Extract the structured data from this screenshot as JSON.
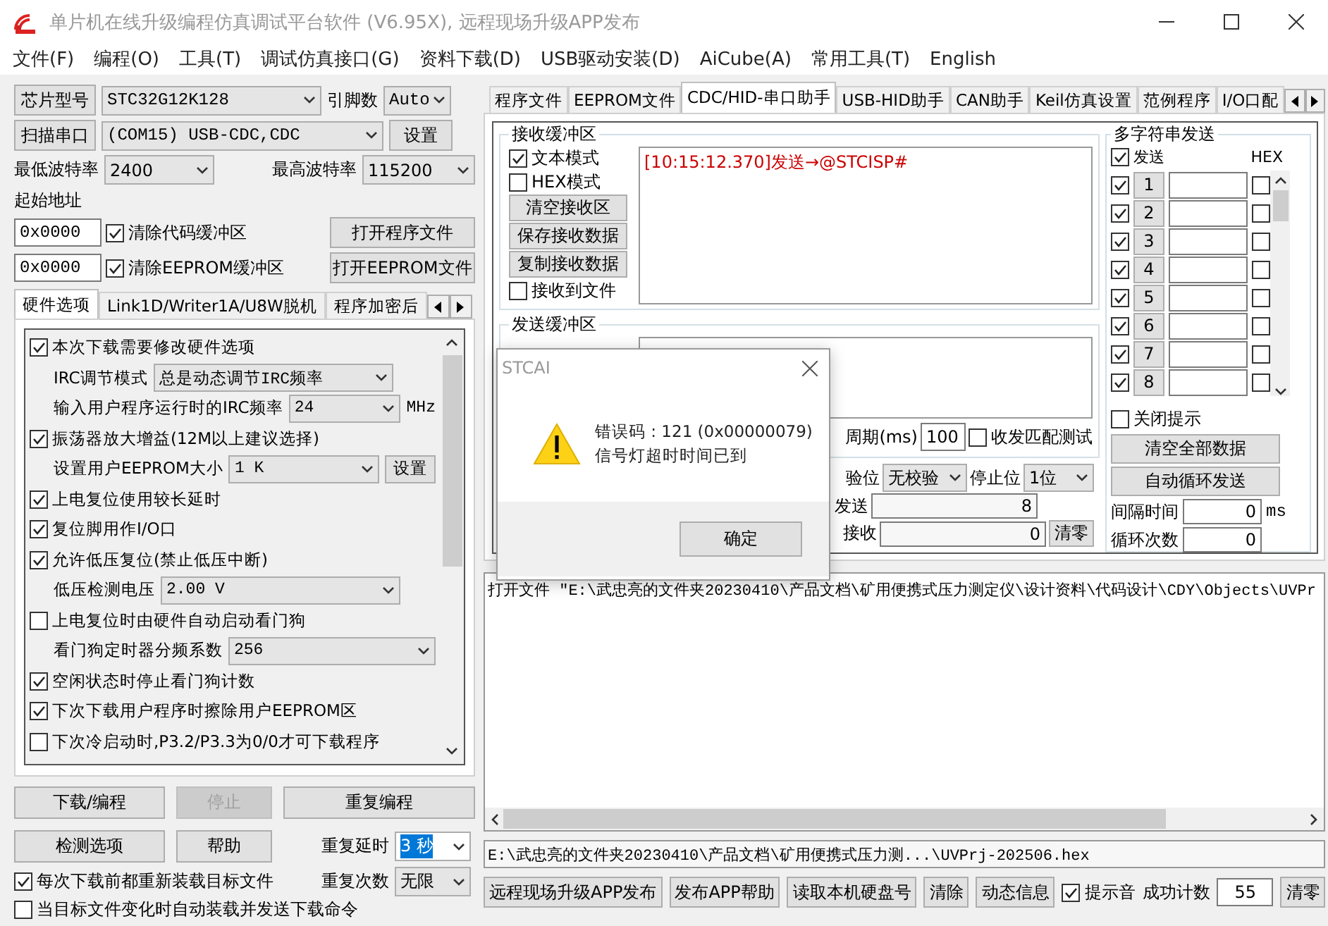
{
  "window": {
    "title": "单片机在线升级编程仿真调试平台软件 (V6.95X), 远程现场升级APP发布"
  },
  "menu": [
    "文件(F)",
    "编程(O)",
    "工具(T)",
    "调试仿真接口(G)",
    "资料下载(D)",
    "USB驱动安装(D)",
    "AiCube(A)",
    "常用工具(T)",
    "English"
  ],
  "chip": {
    "button": "芯片型号",
    "model": "STC32G12K128",
    "pins_label": "引脚数",
    "pins": "Auto"
  },
  "port": {
    "button": "扫描串口",
    "value": "(COM15) USB-CDC,CDC",
    "settings": "设置"
  },
  "baud": {
    "min_label": "最低波特率",
    "min": "2400",
    "max_label": "最高波特率",
    "max": "115200"
  },
  "start_address": {
    "label": "起始地址",
    "rows": [
      {
        "address": "0x0000",
        "label": "清除代码缓冲区",
        "checked": true,
        "button": "打开程序文件"
      },
      {
        "address": "0x0000",
        "label": "清除EEPROM缓冲区",
        "checked": true,
        "button": "打开EEPROM文件"
      }
    ]
  },
  "left_tabs": [
    {
      "label": "硬件选项",
      "selected": true
    },
    {
      "label": "Link1D/Writer1A/U8W脱机",
      "selected": false
    },
    {
      "label": "程序加密后",
      "selected": false
    }
  ],
  "hardware_options": [
    {
      "kind": "check",
      "label": "本次下载需要修改硬件选项",
      "checked": true
    },
    {
      "kind": "select",
      "label": "IRC调节模式",
      "value": "总是动态调节IRC频率"
    },
    {
      "kind": "select",
      "label": "输入用户程序运行时的IRC频率",
      "value": "24",
      "unit": "MHz"
    },
    {
      "kind": "check",
      "label": "振荡器放大增益(12M以上建议选择)",
      "checked": true
    },
    {
      "kind": "select",
      "label": "设置用户EEPROM大小",
      "value": "1    K",
      "button": "设置"
    },
    {
      "kind": "check",
      "label": "上电复位使用较长延时",
      "checked": true
    },
    {
      "kind": "check",
      "label": "复位脚用作I/O口",
      "checked": true
    },
    {
      "kind": "check",
      "label": "允许低压复位(禁止低压中断)",
      "checked": true
    },
    {
      "kind": "select",
      "label": "低压检测电压",
      "value": "2.00 V"
    },
    {
      "kind": "check",
      "label": "上电复位时由硬件自动启动看门狗",
      "checked": false
    },
    {
      "kind": "select",
      "label": "看门狗定时器分频系数",
      "value": "256"
    },
    {
      "kind": "check",
      "label": "空闲状态时停止看门狗计数",
      "checked": true
    },
    {
      "kind": "check",
      "label": "下次下载用户程序时擦除用户EEPROM区",
      "checked": true
    },
    {
      "kind": "check",
      "label": "下次冷启动时,P3.2/P3.3为0/0才可下载程序",
      "checked": false
    }
  ],
  "actions": [
    {
      "label": "下载/编程",
      "disabled": false
    },
    {
      "label": "停止",
      "disabled": true
    },
    {
      "label": "重复编程",
      "disabled": false
    },
    {
      "label": "检测选项",
      "disabled": false
    },
    {
      "label": "帮助",
      "disabled": false
    }
  ],
  "repeat": {
    "delay_label": "重复延时",
    "delay": "3 秒",
    "count_label": "重复次数",
    "count": "无限"
  },
  "reload_options": [
    {
      "label": "每次下载前都重新装载目标文件",
      "checked": true
    },
    {
      "label": "当目标文件变化时自动装载并发送下载命令",
      "checked": false
    }
  ],
  "right_tabs": [
    {
      "label": "程序文件",
      "selected": false
    },
    {
      "label": "EEPROM文件",
      "selected": false
    },
    {
      "label": "CDC/HID-串口助手",
      "selected": true
    },
    {
      "label": "USB-HID助手",
      "selected": false
    },
    {
      "label": "CAN助手",
      "selected": false
    },
    {
      "label": "Keil仿真设置",
      "selected": false
    },
    {
      "label": "范例程序",
      "selected": false
    },
    {
      "label": "I/O口配",
      "selected": false
    }
  ],
  "receive": {
    "title": "接收缓冲区",
    "options": [
      {
        "label": "文本模式",
        "checked": true
      },
      {
        "label": "HEX模式",
        "checked": false
      }
    ],
    "buttons": [
      "清空接收区",
      "保存接收数据",
      "复制接收数据"
    ],
    "to_file": {
      "label": "接收到文件",
      "checked": false
    },
    "log": "[10:15:12.370]发送→@STCISP#"
  },
  "send": {
    "title": "发送缓冲区",
    "period_label": "周期(ms)",
    "period": "100",
    "match_test": {
      "label": "收发匹配测试",
      "checked": false
    },
    "parity_label": "验位",
    "parity": "无校验",
    "stop_label": "停止位",
    "stop": "1位",
    "sent_label": "发送",
    "sent": "8",
    "received_label": "接收",
    "received": "0",
    "clear": "清零"
  },
  "multi_send": {
    "title": "多字符串发送",
    "send_all": {
      "label": "发送",
      "checked": true
    },
    "hex_label": "HEX",
    "rows": [
      {
        "number": "1",
        "checked": true,
        "hex": false
      },
      {
        "number": "2",
        "checked": true,
        "hex": false
      },
      {
        "number": "3",
        "checked": true,
        "hex": false
      },
      {
        "number": "4",
        "checked": true,
        "hex": false
      },
      {
        "number": "5",
        "checked": true,
        "hex": false
      },
      {
        "number": "6",
        "checked": true,
        "hex": false
      },
      {
        "number": "7",
        "checked": true,
        "hex": false
      },
      {
        "number": "8",
        "checked": true,
        "hex": false
      }
    ],
    "close_hint": {
      "label": "关闭提示",
      "checked": false
    },
    "buttons": [
      "清空全部数据",
      "自动循环发送"
    ],
    "interval_label": "间隔时间",
    "interval": "0",
    "interval_unit": "ms",
    "loop_label": "循环次数",
    "loop": "0"
  },
  "output": {
    "text": "打开文件 \"E:\\武忠亮的文件夹20230410\\产品文档\\矿用便携式压力测定仪\\设计资料\\代码设计\\CDY\\Objects\\UVPr"
  },
  "file_path": "E:\\武忠亮的文件夹20230410\\产品文档\\矿用便携式压力测...\\UVPrj-202506.hex",
  "bottom_buttons": [
    "远程现场升级APP发布",
    "发布APP帮助",
    "读取本机硬盘号",
    "清除",
    "动态信息"
  ],
  "beep": {
    "label": "提示音",
    "checked": true
  },
  "success": {
    "label": "成功计数",
    "value": "55",
    "clear": "清零"
  },
  "dialog": {
    "title": "STCAI",
    "lines": [
      "错误码 : 121 (0x00000079)",
      "信号灯超时时间已到"
    ],
    "button": "确定"
  }
}
